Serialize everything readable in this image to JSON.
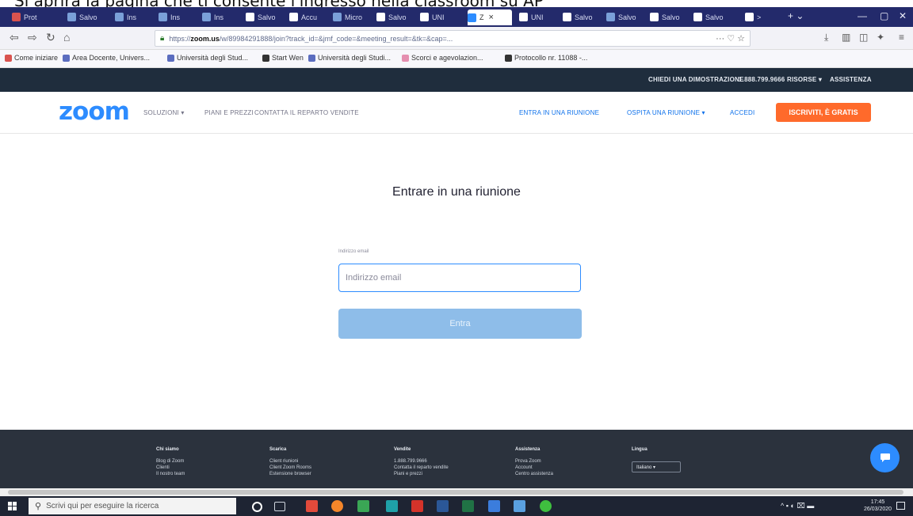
{
  "caption": "Si aprirà la pagina che ti consente l'ingresso nella classroom su AP",
  "browser": {
    "tabs": [
      {
        "label": "Prot",
        "icon_color": "#d9534f"
      },
      {
        "label": "Salvo",
        "icon_color": "#7aa0d8"
      },
      {
        "label": "Ins",
        "icon_color": "#7aa0d8"
      },
      {
        "label": "Ins",
        "icon_color": "#7aa0d8"
      },
      {
        "label": "Ins",
        "icon_color": "#7aa0d8"
      },
      {
        "label": "Salvo",
        "icon_color": "#ffffff"
      },
      {
        "label": "Accu",
        "icon_color": "#ffffff"
      },
      {
        "label": "Micro",
        "icon_color": "#7aa0d8"
      },
      {
        "label": "Salvo",
        "icon_color": "#ffffff"
      },
      {
        "label": "UNI",
        "icon_color": "#ffffff"
      },
      {
        "label": "Z",
        "icon_color": "#2d8cff"
      },
      {
        "label": "UNI",
        "icon_color": "#ffffff"
      },
      {
        "label": "Salvo",
        "icon_color": "#ffffff"
      },
      {
        "label": "Salvo",
        "icon_color": "#7aa0d8"
      },
      {
        "label": "Salvo",
        "icon_color": "#ffffff"
      },
      {
        "label": "Salvo",
        "icon_color": "#ffffff"
      },
      {
        "label": ">",
        "icon_color": "#ffffff"
      }
    ],
    "url_prefix": "https://",
    "url_domain": "zoom.us",
    "url_rest": "/w/89984291888/join?track_id=&jmf_code=&meeting_result=&tk=&cap=...",
    "url_actions": "··· ♡ ☆",
    "bookmarks": [
      {
        "label": "Come iniziare",
        "icon_color": "#d9534f"
      },
      {
        "label": "Area Docente, Univers...",
        "icon_color": "#5b6dbf"
      },
      {
        "label": "Università degli Stud...",
        "icon_color": "#5b6dbf"
      },
      {
        "label": "Start Wen",
        "icon_color": "#333333"
      },
      {
        "label": "Università degli Studi...",
        "icon_color": "#5b6dbf"
      },
      {
        "label": "Scorci e agevolazion...",
        "icon_color": "#e58fb0"
      },
      {
        "label": "Protocollo nr. 11088 -...",
        "icon_color": "#333333"
      }
    ]
  },
  "zoom_topbar": {
    "demo": "CHIEDI UNA DIMOSTRAZIONE",
    "phone": "1.888.799.9666",
    "resources": "RISORSE ▾",
    "support": "ASSISTENZA"
  },
  "zoom_header": {
    "logo": "zoom",
    "solutions": "SOLUZIONI ▾",
    "plans": "PIANI E PREZZI",
    "contact": "CONTATTA IL REPARTO VENDITE",
    "join": "ENTRA IN UNA RIUNIONE",
    "host": "OSPITA UNA RIUNIONE ▾",
    "signin": "ACCEDI",
    "signup": "ISCRIVITI, È GRATIS"
  },
  "join_form": {
    "title": "Entrare in una riunione",
    "email_label": "Indirizzo email",
    "email_placeholder": "Indirizzo email",
    "submit": "Entra"
  },
  "footer": {
    "columns": [
      {
        "heading": "Chi siamo",
        "items": [
          "Blog di Zoom",
          "Clienti",
          "Il nostro team"
        ]
      },
      {
        "heading": "Scarica",
        "items": [
          "Client riunioni",
          "Client Zoom Rooms",
          "Estensione browser"
        ]
      },
      {
        "heading": "Vendite",
        "items": [
          "1.888.799.9666",
          "Contatta il reparto vendite",
          "Piani e prezzi"
        ]
      },
      {
        "heading": "Assistenza",
        "items": [
          "Prova Zoom",
          "Account",
          "Centro assistenza"
        ]
      }
    ],
    "language_heading": "Lingua",
    "language_value": "Italiano ▾"
  },
  "taskbar": {
    "search_placeholder": "Scrivi qui per eseguire la ricerca",
    "apps": [
      {
        "name": "cortana",
        "color": "#ffffff"
      },
      {
        "name": "task-view",
        "color": "#cfd5de"
      },
      {
        "name": "app-red",
        "color": "#e24a3b"
      },
      {
        "name": "firefox",
        "color": "#f4862a"
      },
      {
        "name": "app-green",
        "color": "#3aa655"
      },
      {
        "name": "app-teal",
        "color": "#1fa1a8"
      },
      {
        "name": "acrobat",
        "color": "#d4332a"
      },
      {
        "name": "word",
        "color": "#2b5797"
      },
      {
        "name": "excel",
        "color": "#207245"
      },
      {
        "name": "app-blue",
        "color": "#3b7ddd"
      },
      {
        "name": "app-multi",
        "color": "#5aa0e0"
      },
      {
        "name": "app-green-circle",
        "color": "#3fbf3f"
      }
    ],
    "time": "17:45",
    "date": "26/03/2020"
  },
  "colors": {
    "zoom_blue": "#2d8cff",
    "signup_orange": "#ff6a2b",
    "join_button": "#8ebde9",
    "footer_bg": "#2b323d",
    "topbar_bg": "#1f2d3d",
    "tabbar_bg": "#232a6b"
  }
}
